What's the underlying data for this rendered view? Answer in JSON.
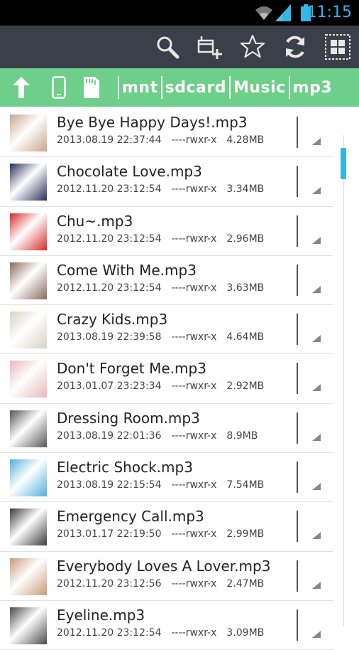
{
  "status_bar": {
    "time": "11:15"
  },
  "action_bar": {
    "buttons": [
      {
        "icon": "search-icon"
      },
      {
        "icon": "add-window-icon"
      },
      {
        "icon": "star-icon"
      },
      {
        "icon": "refresh-icon"
      },
      {
        "icon": "grid-view-icon"
      }
    ]
  },
  "path_bar": {
    "icons": [
      "up-arrow-icon",
      "phone-icon",
      "sdcard-icon"
    ],
    "crumbs": [
      "mnt",
      "sdcard",
      "Music",
      "mp3"
    ]
  },
  "files": [
    {
      "name": "Bye Bye Happy Days!.mp3",
      "date": "2013.08.19 22:37:44",
      "perm": "----rwxr-x",
      "size": "4.28MB",
      "thumb_color": "#c9a48a"
    },
    {
      "name": "Chocolate Love.mp3",
      "date": "2012.11.20 23:12:54",
      "perm": "----rwxr-x",
      "size": "3.34MB",
      "thumb_color": "#2a2d5a"
    },
    {
      "name": "Chu~.mp3",
      "date": "2012.11.20 23:12:54",
      "perm": "----rwxr-x",
      "size": "2.96MB",
      "thumb_color": "#d62a2a"
    },
    {
      "name": "Come With Me.mp3",
      "date": "2012.11.20 23:12:54",
      "perm": "----rwxr-x",
      "size": "3.63MB",
      "thumb_color": "#8a6a5a"
    },
    {
      "name": "Crazy Kids.mp3",
      "date": "2013.08.19 22:39:58",
      "perm": "----rwxr-x",
      "size": "4.64MB",
      "thumb_color": "#d8d2c4"
    },
    {
      "name": "Don't Forget Me.mp3",
      "date": "2013.01.07 23:23:34",
      "perm": "----rwxr-x",
      "size": "2.92MB",
      "thumb_color": "#e8b8b8"
    },
    {
      "name": "Dressing Room.mp3",
      "date": "2013.08.19 22:01:36",
      "perm": "----rwxr-x",
      "size": "8.9MB",
      "thumb_color": "#555555"
    },
    {
      "name": "Electric Shock.mp3",
      "date": "2013.08.19 22:15:54",
      "perm": "----rwxr-x",
      "size": "7.54MB",
      "thumb_color": "#4fb0d8"
    },
    {
      "name": "Emergency Call.mp3",
      "date": "2013.01.17 22:19:50",
      "perm": "----rwxr-x",
      "size": "2.99MB",
      "thumb_color": "#3a3a3a"
    },
    {
      "name": "Everybody Loves A Lover.mp3",
      "date": "2012.11.20 23:12:56",
      "perm": "----rwxr-x",
      "size": "2.47MB",
      "thumb_color": "#c89a78"
    },
    {
      "name": "Eyeline.mp3",
      "date": "2012.11.20 23:12:54",
      "perm": "----rwxr-x",
      "size": "3.09MB",
      "thumb_color": "#4a4a4a"
    }
  ]
}
